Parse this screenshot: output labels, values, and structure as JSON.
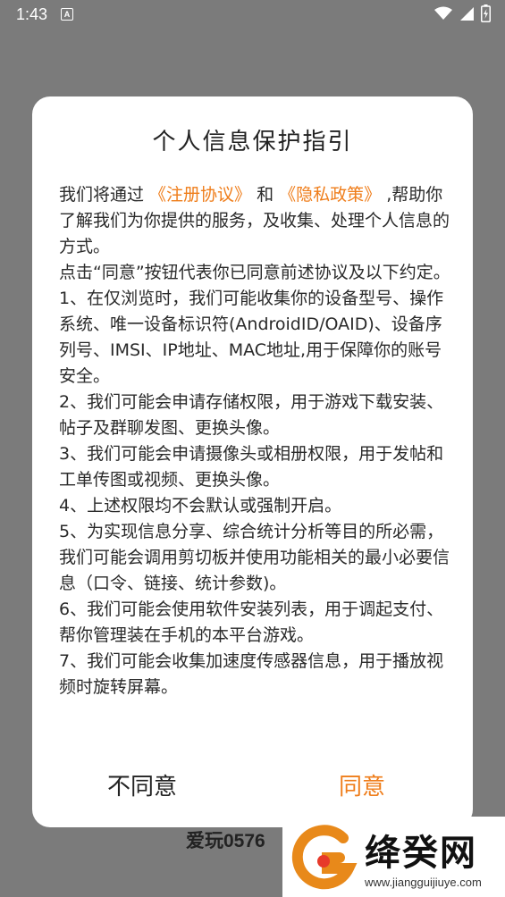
{
  "status_bar": {
    "time": "1:43",
    "notification_icon": "a-icon"
  },
  "background": {
    "brand_text": "爱玩0576"
  },
  "dialog": {
    "title": "个人信息保护指引",
    "intro": {
      "prefix": "我们将通过 ",
      "link1": "《注册协议》",
      "middle": " 和 ",
      "link2": "《隐私政策》",
      "suffix": " ,帮助你了解我们为你提供的服务，及收集、处理个人信息的方式。"
    },
    "paragraphs": [
      "点击“同意”按钮代表你已同意前述协议及以下约定。",
      "1、在仅浏览时，我们可能收集你的设备型号、操作系统、唯一设备标识符(AndroidID/OAID)、设备序列号、IMSI、IP地址、MAC地址,用于保障你的账号安全。",
      "2、我们可能会申请存储权限，用于游戏下载安装、帖子及群聊发图、更换头像。",
      "3、我们可能会申请摄像头或相册权限，用于发帖和工单传图或视频、更换头像。",
      "4、上述权限均不会默认或强制开启。",
      "5、为实现信息分享、综合统计分析等目的所必需，我们可能会调用剪切板并使用功能相关的最小必要信息（口令、链接、统计参数)。",
      "6、我们可能会使用软件安装列表，用于调起支付、帮你管理装在手机的本平台游戏。",
      "7、我们可能会收集加速度传感器信息，用于播放视频时旋转屏幕。"
    ],
    "buttons": {
      "disagree": "不同意",
      "agree": "同意"
    },
    "accent_color": "#ef7d1a"
  },
  "watermark": {
    "name": "绛癸网",
    "url": "www.jiangguijiuye.com"
  }
}
